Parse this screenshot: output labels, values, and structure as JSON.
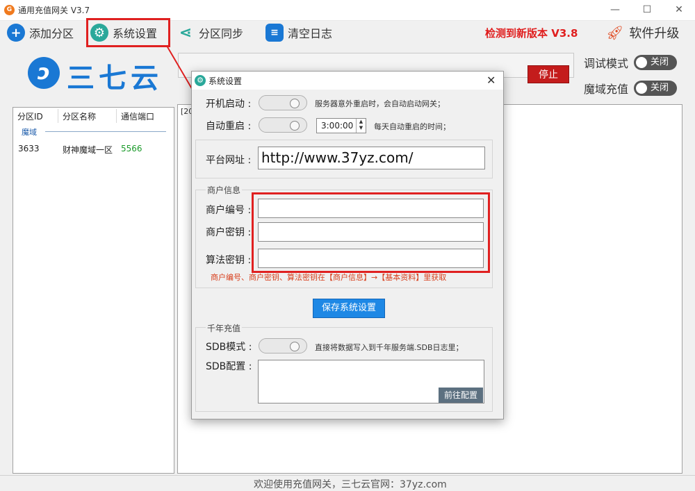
{
  "window": {
    "title": "通用充值网关 V3.7",
    "app_icon_glyph": "G"
  },
  "toolbar": {
    "add_partition": "添加分区",
    "system_settings": "系统设置",
    "partition_sync": "分区同步",
    "clear_log": "清空日志",
    "new_version_notice": "检测到新版本 V3.8",
    "upgrade": "软件升级"
  },
  "brand": {
    "logo_glyph": "ↄ",
    "name": "三七云"
  },
  "controls": {
    "stop_label": "停止",
    "debug_mode_label": "调试模式",
    "debug_mode_state": "关闭",
    "moyu_charge_label": "魔域充值",
    "moyu_charge_state": "关闭"
  },
  "partition_table": {
    "headers": [
      "分区ID",
      "分区名称",
      "通信端口"
    ],
    "group": "魔域",
    "rows": [
      {
        "id": "3633",
        "name": "财神魔域一区",
        "port": "5566"
      }
    ]
  },
  "log": {
    "first_line_prefix": "[20"
  },
  "dialog": {
    "title": "系统设置",
    "close": "✕",
    "auto_start_label": "开机启动 :",
    "auto_start_hint": "服务器意外重启时，会自动启动网关；",
    "auto_restart_label": "自动重启 :",
    "auto_restart_time": "3:00:00",
    "auto_restart_hint": "每天自动重启的时间；",
    "platform_url_label": "平台网址 :",
    "platform_url_value": "http://www.37yz.com/",
    "merchant_group": "商户信息",
    "merchant_id_label": "商户编号 :",
    "merchant_id_value": "",
    "merchant_key_label": "商户密钥 :",
    "merchant_key_value": "",
    "algo_key_label": "算法密钥 :",
    "algo_key_value": "",
    "merchant_note": "商户编号、商户密钥、算法密钥在【商户信息】→【基本资料】里获取",
    "save_button": "保存系统设置",
    "qiannian_group": "千年充值",
    "sdb_mode_label": "SDB模式 :",
    "sdb_mode_hint": "直接将数据写入到千年服务端.SDB日志里；",
    "sdb_config_label": "SDB配置 :",
    "sdb_config_value": "",
    "goto_config_button": "前往配置"
  },
  "statusbar": {
    "text": "欢迎使用充值网关，三七云官网：37yz.com"
  },
  "colors": {
    "accent_red": "#e02020",
    "brand_blue": "#1a78d4",
    "save_blue": "#1e88e5",
    "stop_red": "#c41c1c",
    "port_green": "#1a9a2a"
  }
}
